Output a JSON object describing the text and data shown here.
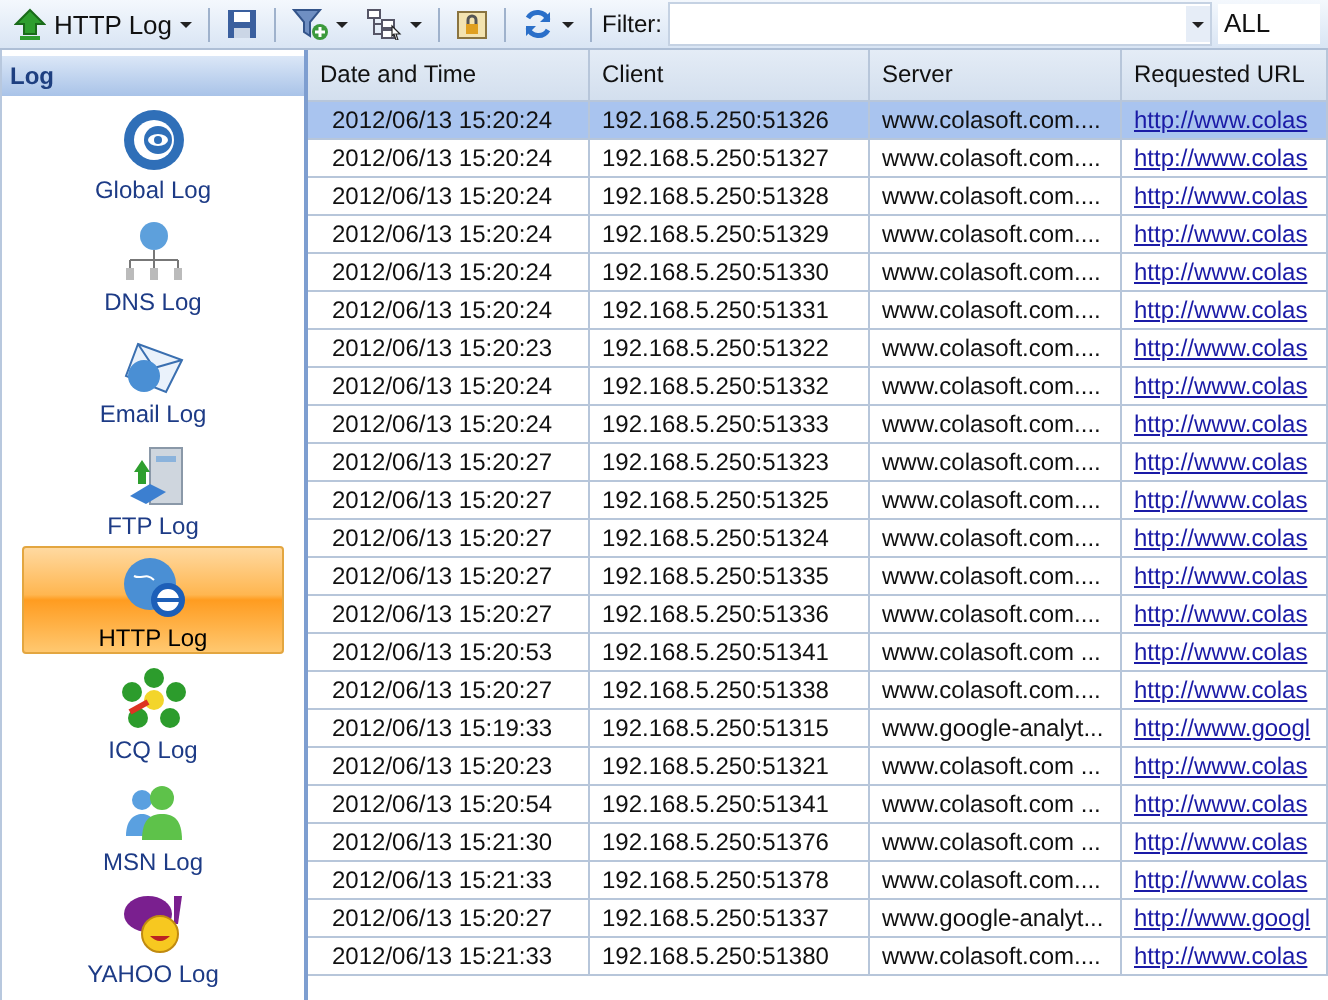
{
  "toolbar": {
    "log_menu": {
      "label": "HTTP Log"
    },
    "filter": {
      "label": "Filter:"
    },
    "scope": {
      "value": "ALL"
    }
  },
  "sidebar": {
    "title": "Log",
    "items": [
      {
        "label": "Global Log",
        "kind": "global",
        "selected": false
      },
      {
        "label": "DNS Log",
        "kind": "dns",
        "selected": false
      },
      {
        "label": "Email Log",
        "kind": "email",
        "selected": false
      },
      {
        "label": "FTP Log",
        "kind": "ftp",
        "selected": false
      },
      {
        "label": "HTTP Log",
        "kind": "http",
        "selected": true
      },
      {
        "label": "ICQ Log",
        "kind": "icq",
        "selected": false
      },
      {
        "label": "MSN Log",
        "kind": "msn",
        "selected": false
      },
      {
        "label": "YAHOO Log",
        "kind": "yahoo",
        "selected": false
      }
    ]
  },
  "table": {
    "columns": [
      "Date and Time",
      "Client",
      "Server",
      "Requested URL"
    ],
    "rows": [
      {
        "cells": [
          "2012/06/13 15:20:24",
          "192.168.5.250:51326",
          "www.colasoft.com....",
          "http://www.colas"
        ],
        "selected": true
      },
      {
        "cells": [
          "2012/06/13 15:20:24",
          "192.168.5.250:51327",
          "www.colasoft.com....",
          "http://www.colas"
        ],
        "selected": false
      },
      {
        "cells": [
          "2012/06/13 15:20:24",
          "192.168.5.250:51328",
          "www.colasoft.com....",
          "http://www.colas"
        ],
        "selected": false
      },
      {
        "cells": [
          "2012/06/13 15:20:24",
          "192.168.5.250:51329",
          "www.colasoft.com....",
          "http://www.colas"
        ],
        "selected": false
      },
      {
        "cells": [
          "2012/06/13 15:20:24",
          "192.168.5.250:51330",
          "www.colasoft.com....",
          "http://www.colas"
        ],
        "selected": false
      },
      {
        "cells": [
          "2012/06/13 15:20:24",
          "192.168.5.250:51331",
          "www.colasoft.com....",
          "http://www.colas"
        ],
        "selected": false
      },
      {
        "cells": [
          "2012/06/13 15:20:23",
          "192.168.5.250:51322",
          "www.colasoft.com....",
          "http://www.colas"
        ],
        "selected": false
      },
      {
        "cells": [
          "2012/06/13 15:20:24",
          "192.168.5.250:51332",
          "www.colasoft.com....",
          "http://www.colas"
        ],
        "selected": false
      },
      {
        "cells": [
          "2012/06/13 15:20:24",
          "192.168.5.250:51333",
          "www.colasoft.com....",
          "http://www.colas"
        ],
        "selected": false
      },
      {
        "cells": [
          "2012/06/13 15:20:27",
          "192.168.5.250:51323",
          "www.colasoft.com....",
          "http://www.colas"
        ],
        "selected": false
      },
      {
        "cells": [
          "2012/06/13 15:20:27",
          "192.168.5.250:51325",
          "www.colasoft.com....",
          "http://www.colas"
        ],
        "selected": false
      },
      {
        "cells": [
          "2012/06/13 15:20:27",
          "192.168.5.250:51324",
          "www.colasoft.com....",
          "http://www.colas"
        ],
        "selected": false
      },
      {
        "cells": [
          "2012/06/13 15:20:27",
          "192.168.5.250:51335",
          "www.colasoft.com....",
          "http://www.colas"
        ],
        "selected": false
      },
      {
        "cells": [
          "2012/06/13 15:20:27",
          "192.168.5.250:51336",
          "www.colasoft.com....",
          "http://www.colas"
        ],
        "selected": false
      },
      {
        "cells": [
          "2012/06/13 15:20:53",
          "192.168.5.250:51341",
          "www.colasoft.com ...",
          "http://www.colas"
        ],
        "selected": false
      },
      {
        "cells": [
          "2012/06/13 15:20:27",
          "192.168.5.250:51338",
          "www.colasoft.com....",
          "http://www.colas"
        ],
        "selected": false
      },
      {
        "cells": [
          "2012/06/13 15:19:33",
          "192.168.5.250:51315",
          "www.google-analyt...",
          "http://www.googl"
        ],
        "selected": false
      },
      {
        "cells": [
          "2012/06/13 15:20:23",
          "192.168.5.250:51321",
          "www.colasoft.com ...",
          "http://www.colas"
        ],
        "selected": false
      },
      {
        "cells": [
          "2012/06/13 15:20:54",
          "192.168.5.250:51341",
          "www.colasoft.com ...",
          "http://www.colas"
        ],
        "selected": false
      },
      {
        "cells": [
          "2012/06/13 15:21:30",
          "192.168.5.250:51376",
          "www.colasoft.com ...",
          "http://www.colas"
        ],
        "selected": false
      },
      {
        "cells": [
          "2012/06/13 15:21:33",
          "192.168.5.250:51378",
          "www.colasoft.com....",
          "http://www.colas"
        ],
        "selected": false
      },
      {
        "cells": [
          "2012/06/13 15:20:27",
          "192.168.5.250:51337",
          "www.google-analyt...",
          "http://www.googl"
        ],
        "selected": false
      },
      {
        "cells": [
          "2012/06/13 15:21:33",
          "192.168.5.250:51380",
          "www.colasoft.com....",
          "http://www.colas"
        ],
        "selected": false
      }
    ]
  }
}
